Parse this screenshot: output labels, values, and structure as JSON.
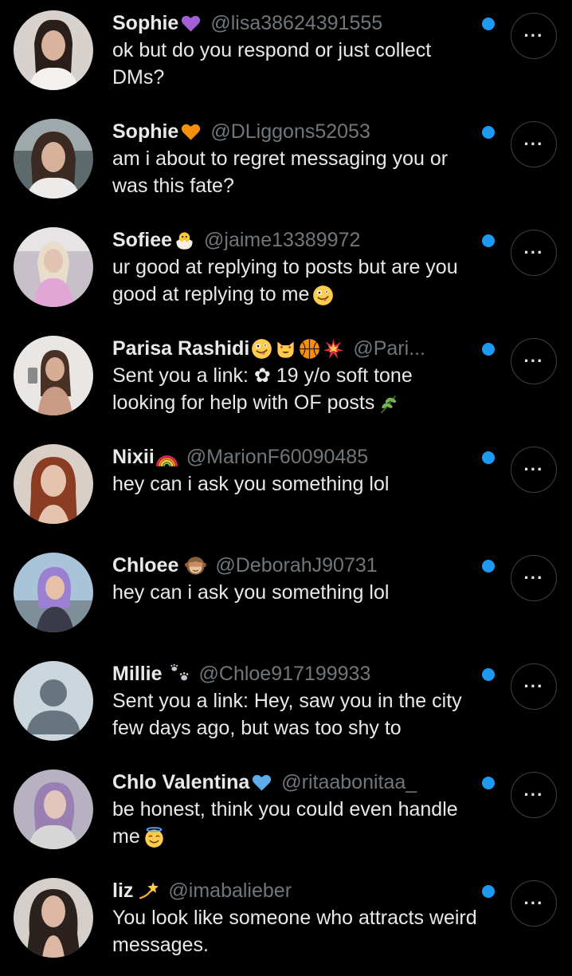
{
  "colors": {
    "background": "#000000",
    "primary_text": "#e7e9ea",
    "secondary_text": "#71767b",
    "unread_dot": "#1d9bf0",
    "button_border": "#3e4144"
  },
  "conversations": [
    {
      "name": "Sophie",
      "name_emojis": [
        "purple-heart"
      ],
      "handle": "@lisa38624391555",
      "message": "ok but do you respond or just collect DMs?",
      "message_emoji": null,
      "unread": true,
      "more_label": "···",
      "avatar": "photo"
    },
    {
      "name": "Sophie",
      "name_emojis": [
        "orange-heart"
      ],
      "handle": "@DLiggons52053",
      "message": "am i about to regret messaging you or was this fate?",
      "message_emoji": null,
      "unread": true,
      "more_label": "···",
      "avatar": "photo"
    },
    {
      "name": "Sofiee",
      "name_emojis": [
        "hatching-chick"
      ],
      "handle": "@jaime13389972",
      "message": "ur good at replying to posts but are you good at replying to me",
      "message_emoji": "zany-face",
      "unread": true,
      "more_label": "···",
      "avatar": "photo"
    },
    {
      "name": "Parisa Rashidi",
      "name_emojis": [
        "zany-face",
        "heart-eyes-cat",
        "basketball",
        "collision"
      ],
      "handle": "@Pari...",
      "message": "Sent you a link: ✿ 19 y/o soft tone looking for help with OF posts",
      "message_emoji": "herb",
      "unread": true,
      "more_label": "···",
      "avatar": "photo"
    },
    {
      "name": "Nixii",
      "name_emojis": [
        "rainbow"
      ],
      "handle": "@MarionF60090485",
      "message": "hey can i ask you something lol",
      "message_emoji": null,
      "unread": true,
      "more_label": "···",
      "avatar": "photo"
    },
    {
      "name": "Chloee",
      "name_emojis": [
        "see-no-evil-monkey"
      ],
      "handle": "@DeborahJ90731",
      "message": "hey can i ask you something lol",
      "message_emoji": null,
      "unread": true,
      "more_label": "···",
      "avatar": "photo"
    },
    {
      "name": "Millie",
      "name_emojis": [
        "paw-prints"
      ],
      "handle": "@Chloe917199933",
      "message": "Sent you a link: Hey, saw you in the city few days ago, but was too shy to",
      "message_emoji": null,
      "unread": true,
      "more_label": "···",
      "avatar": "default"
    },
    {
      "name": "Chlo Valentina",
      "name_emojis": [
        "blue-heart"
      ],
      "handle": "@ritaabonitaa_",
      "message": "be honest, think you could even handle me",
      "message_emoji": "smiling-face-with-halo",
      "unread": true,
      "more_label": "···",
      "avatar": "photo"
    },
    {
      "name": "liz",
      "name_emojis": [
        "dizzy"
      ],
      "handle": "@imabalieber",
      "message": "You look like someone who attracts weird messages.",
      "message_emoji": null,
      "unread": true,
      "more_label": "···",
      "avatar": "photo"
    }
  ]
}
